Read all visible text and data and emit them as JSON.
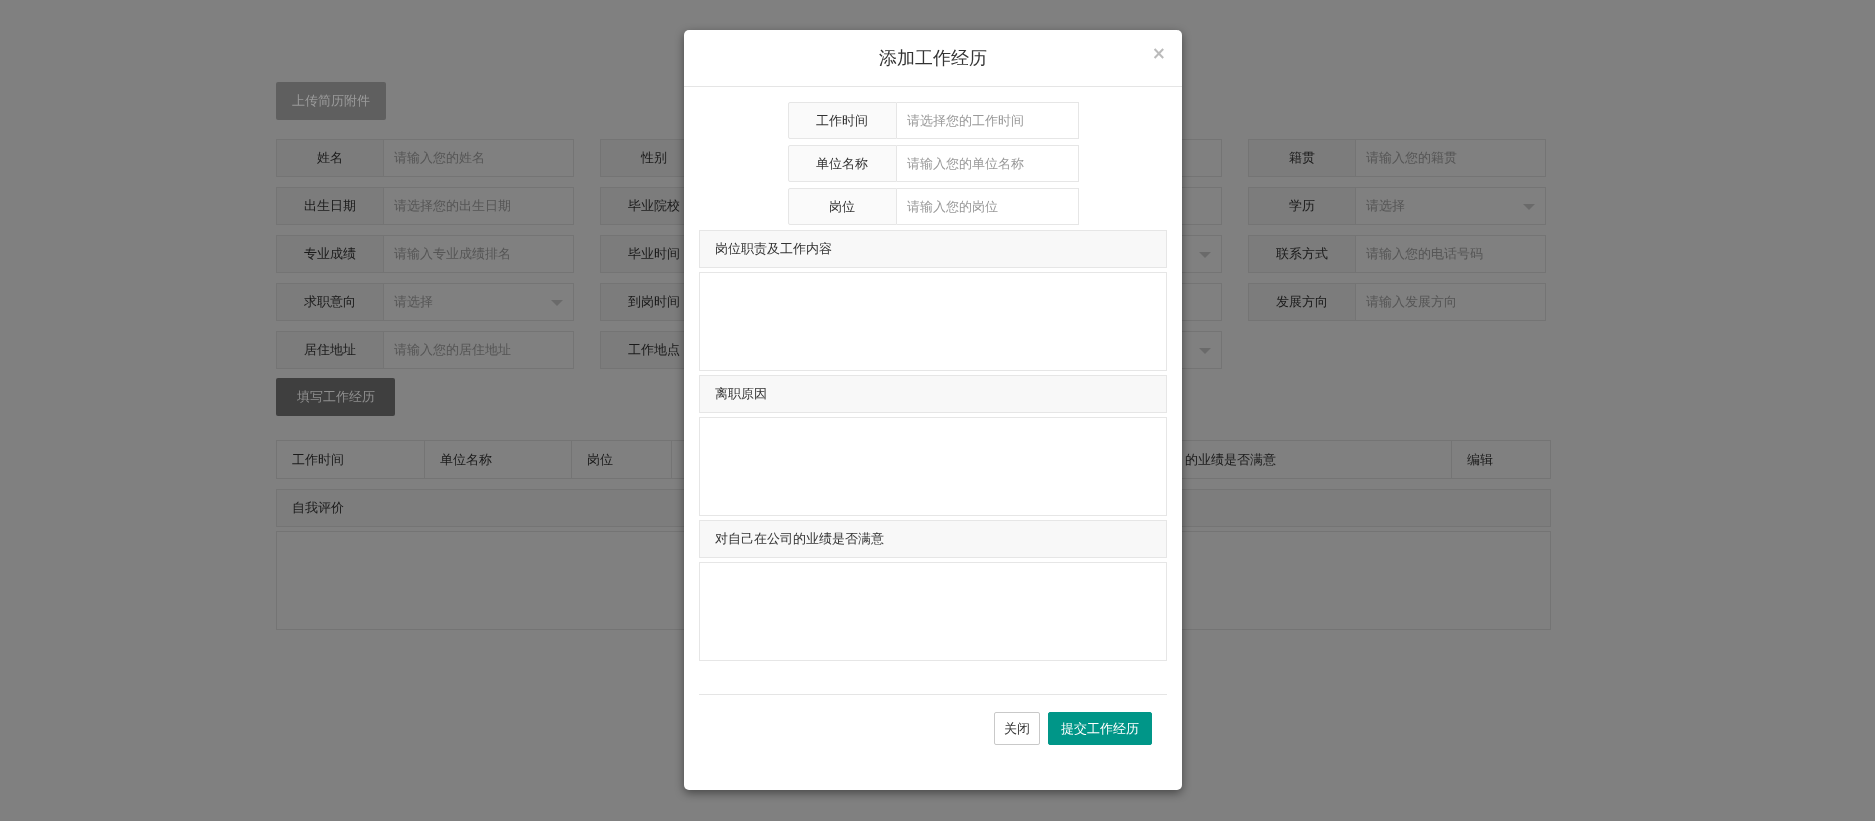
{
  "page": {
    "upload_button": "上传简历附件",
    "work_button": "填写工作经历"
  },
  "form_rows": [
    [
      {
        "label": "姓名",
        "placeholder": "请输入您的姓名",
        "kind": "input"
      },
      {
        "label": "性别",
        "kind": "input"
      },
      {
        "kind": "input"
      },
      {
        "label": "籍贯",
        "placeholder": "请输入您的籍贯",
        "kind": "input"
      }
    ],
    [
      {
        "label": "出生日期",
        "placeholder": "请选择您的出生日期",
        "kind": "input"
      },
      {
        "label": "毕业院校",
        "kind": "input"
      },
      {
        "kind": "input"
      },
      {
        "label": "学历",
        "placeholder": "请选择",
        "kind": "select"
      }
    ],
    [
      {
        "label": "专业成绩",
        "placeholder": "请输入专业成绩排名",
        "kind": "input"
      },
      {
        "label": "毕业时间",
        "kind": "input"
      },
      {
        "kind": "select"
      },
      {
        "label": "联系方式",
        "placeholder": "请输入您的电话号码",
        "kind": "input"
      }
    ],
    [
      {
        "label": "求职意向",
        "placeholder": "请选择",
        "kind": "select"
      },
      {
        "label": "到岗时间",
        "kind": "input"
      },
      {
        "kind": "input"
      },
      {
        "label": "发展方向",
        "placeholder": "请输入发展方向",
        "kind": "input"
      }
    ],
    [
      {
        "label": "居住地址",
        "placeholder": "请输入您的居住地址",
        "kind": "input"
      },
      {
        "label": "工作地点",
        "kind": "input"
      },
      {
        "kind": "select"
      }
    ]
  ],
  "experience_table": {
    "columns": [
      "工作时间",
      "单位名称",
      "岗位",
      "的业绩是否满意",
      "编辑"
    ]
  },
  "self_evaluation": {
    "label": "自我评价"
  },
  "modal": {
    "title": "添加工作经历",
    "close": "×",
    "fields": [
      {
        "label": "工作时间",
        "placeholder": "请选择您的工作时间"
      },
      {
        "label": "单位名称",
        "placeholder": "请输入您的单位名称"
      },
      {
        "label": "岗位",
        "placeholder": "请输入您的岗位"
      }
    ],
    "sections": [
      {
        "label": "岗位职责及工作内容"
      },
      {
        "label": "离职原因"
      },
      {
        "label": "对自己在公司的业绩是否满意"
      }
    ],
    "buttons": [
      {
        "label": "关闭",
        "kind": "default"
      },
      {
        "label": "提交工作经历",
        "kind": "primary"
      }
    ]
  }
}
